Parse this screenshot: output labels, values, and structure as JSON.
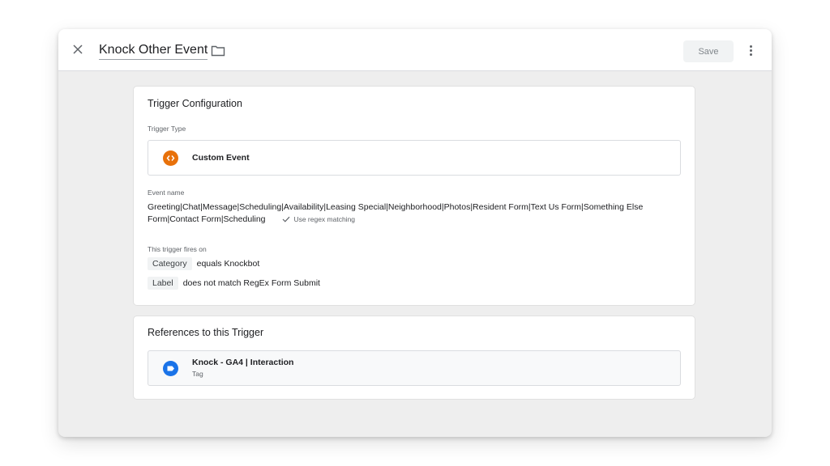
{
  "header": {
    "title": "Knock Other Event",
    "save_label": "Save"
  },
  "config": {
    "heading": "Trigger Configuration",
    "type_label": "Trigger Type",
    "type_value": "Custom Event",
    "event_name_label": "Event name",
    "event_name_value": "Greeting|Chat|Message|Scheduling|Availability|Leasing Special|Neighborhood|Photos|Resident Form|Text Us Form|Something Else Form|Contact Form|Scheduling",
    "regex_label": "Use regex matching",
    "fires_on_label": "This trigger fires on",
    "conditions": [
      {
        "variable": "Category",
        "rule": "equals Knockbot"
      },
      {
        "variable": "Label",
        "rule": "does not match RegEx Form Submit"
      }
    ]
  },
  "references": {
    "heading": "References to this Trigger",
    "items": [
      {
        "name": "Knock - GA4 | Interaction",
        "type": "Tag"
      }
    ]
  },
  "colors": {
    "custom_event_icon": "#e8710a",
    "tag_icon": "#1a73e8"
  },
  "icons": [
    "close-icon",
    "folder-icon",
    "more-vert-icon",
    "custom-event-icon",
    "check-icon",
    "tag-icon"
  ]
}
